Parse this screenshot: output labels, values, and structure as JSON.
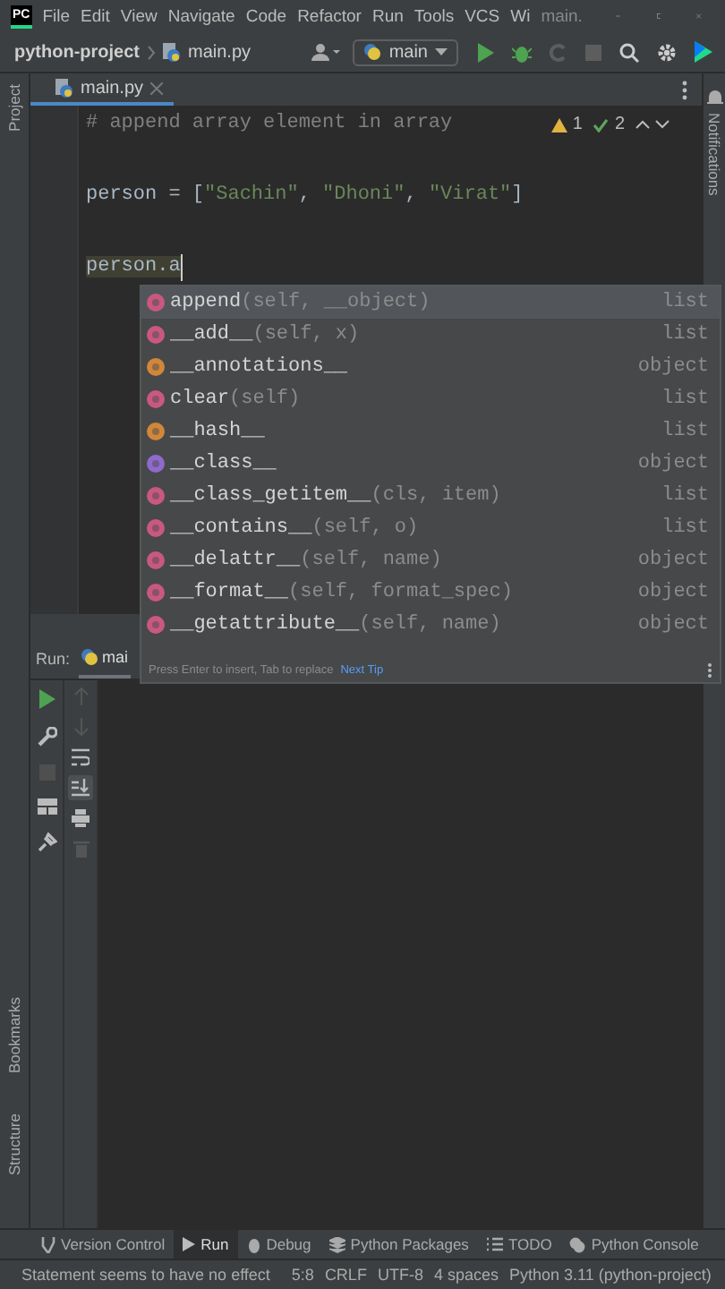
{
  "window": {
    "logo": "PC",
    "menu": [
      "File",
      "Edit",
      "View",
      "Navigate",
      "Code",
      "Refactor",
      "Run",
      "Tools",
      "VCS",
      "Wi"
    ],
    "title": "main."
  },
  "navbar": {
    "project": "python-project",
    "file": "main.py",
    "run_config": "main",
    "toolbar": [
      {
        "disabled": false
      },
      {
        "disabled": false
      },
      {
        "disabled": true
      },
      {
        "disabled": true
      }
    ]
  },
  "tool_stripes": {
    "left_top": "Project",
    "left_bottom": [
      "Bookmarks",
      "Structure"
    ],
    "right": "Notifications"
  },
  "editor_tabs": [
    {
      "label": "main.py",
      "selected": true
    }
  ],
  "inspections": {
    "warnings": "1",
    "weak_warnings": "2"
  },
  "code_lines": [
    {
      "caret": false,
      "tokens": [
        {
          "text": "# append array element in array",
          "kind": "comment"
        }
      ]
    },
    {
      "caret": false,
      "tokens": [
        {
          "text": "person = [",
          "kind": "plain"
        },
        {
          "text": "\"Sachin\"",
          "kind": "string"
        },
        {
          "text": ", ",
          "kind": "plain"
        },
        {
          "text": "\"Dhoni\"",
          "kind": "string"
        },
        {
          "text": ", ",
          "kind": "plain"
        },
        {
          "text": "\"Virat\"",
          "kind": "string"
        },
        {
          "text": "]",
          "kind": "plain"
        }
      ]
    },
    {
      "caret": true,
      "tokens": [
        {
          "text": "person.a",
          "kind": "warning"
        }
      ]
    }
  ],
  "completion": {
    "items": [
      {
        "kind": "method",
        "name": "append",
        "signature": "(self, __object)",
        "type": "list",
        "selected": true
      },
      {
        "kind": "method",
        "name": "__add__",
        "signature": "(self, x)",
        "type": "list",
        "selected": false
      },
      {
        "kind": "field",
        "name": "__annotations__",
        "type": "object",
        "selected": false
      },
      {
        "kind": "method",
        "name": "clear",
        "signature": "(self)",
        "type": "list",
        "selected": false
      },
      {
        "kind": "field",
        "name": "__hash__",
        "type": "list",
        "selected": false
      },
      {
        "kind": "property",
        "name": "__class__",
        "type": "object",
        "selected": false
      },
      {
        "kind": "method",
        "name": "__class_getitem__",
        "signature": "(cls, item)",
        "type": "list",
        "selected": false
      },
      {
        "kind": "method",
        "name": "__contains__",
        "signature": "(self, o)",
        "type": "list",
        "selected": false
      },
      {
        "kind": "method",
        "name": "__delattr__",
        "signature": "(self, name)",
        "type": "object",
        "selected": false
      },
      {
        "kind": "method",
        "name": "__format__",
        "signature": "(self, format_spec)",
        "type": "object",
        "selected": false
      },
      {
        "kind": "method",
        "name": "__getattribute__",
        "signature": "(self, name)",
        "type": "object",
        "selected": false
      }
    ],
    "hint": "Press Enter to insert, Tab to replace",
    "tip_link": "Next Tip"
  },
  "run_panel": {
    "title": "Run:",
    "tab": "mai",
    "actions": [
      {
        "disabled": false
      },
      {
        "disabled": false
      },
      {
        "disabled": true
      },
      {
        "disabled": false
      },
      {
        "disabled": false
      }
    ],
    "console_actions": [
      {
        "disabled": true,
        "selected": false
      },
      {
        "disabled": true,
        "selected": false
      },
      {
        "disabled": false,
        "selected": false
      },
      {
        "disabled": false,
        "selected": true
      },
      {
        "disabled": false,
        "selected": false
      },
      {
        "disabled": true,
        "selected": false
      }
    ]
  },
  "bottom_tabs": [
    {
      "label": "Version Control",
      "selected": false
    },
    {
      "label": "Run",
      "selected": true
    },
    {
      "label": "Debug",
      "selected": false
    },
    {
      "label": "Python Packages",
      "selected": false
    },
    {
      "label": "TODO",
      "selected": false
    },
    {
      "label": "Python Console",
      "selected": false
    }
  ],
  "status_bar": {
    "message": "Statement seems to have no effect",
    "position": "5:8",
    "line_separator": "CRLF",
    "encoding": "UTF-8",
    "indent": "4 spaces",
    "interpreter": "Python 3.11 (python-project)"
  }
}
